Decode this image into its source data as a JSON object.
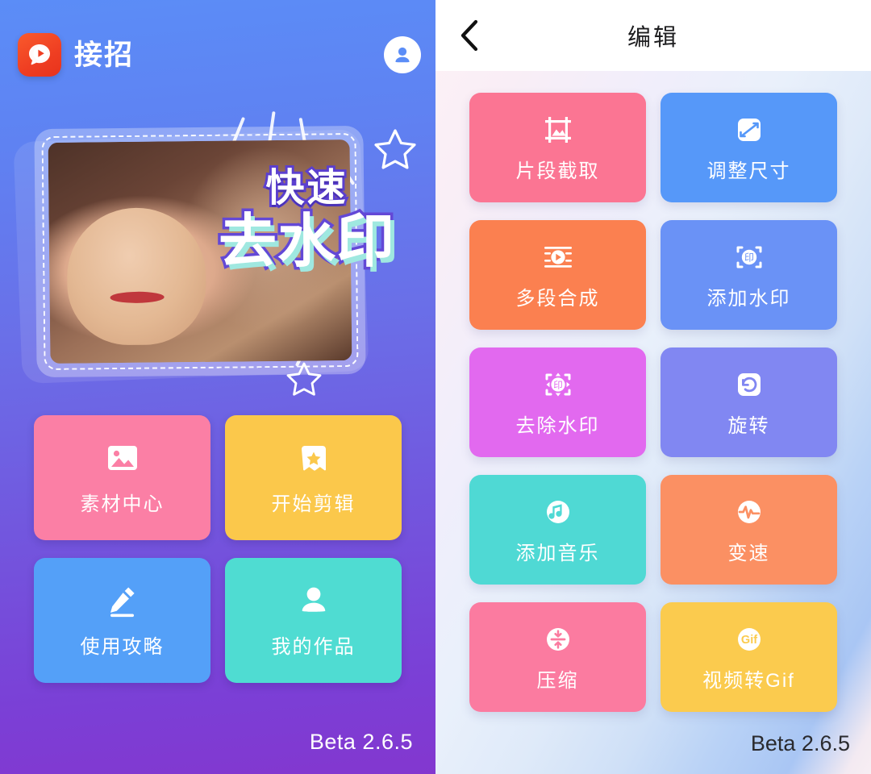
{
  "app": {
    "name": "接招",
    "logo_icon": "play-bubble-icon",
    "avatar_icon": "account-avatar-icon",
    "version": "Beta 2.6.5"
  },
  "home": {
    "hero": {
      "line1": "快速",
      "line2": "去水印",
      "photo_alt": "smiling-woman-photo",
      "colors": {
        "text_fill": "#ffffff",
        "text_stroke": "#5b3fd0",
        "text_shadow": "#9fe8e0"
      }
    },
    "tiles": [
      {
        "label": "素材中心",
        "icon": "image-icon",
        "color": "#fb7fa5"
      },
      {
        "label": "开始剪辑",
        "icon": "star-badge-icon",
        "color": "#fbc84b"
      },
      {
        "label": "使用攻略",
        "icon": "pencil-icon",
        "color": "#54a0f8"
      },
      {
        "label": "我的作品",
        "icon": "person-icon",
        "color": "#4fdcd2"
      }
    ],
    "background": {
      "top": "#5b8df7",
      "bottom": "#8337cf"
    }
  },
  "edit": {
    "title": "编辑",
    "back_icon": "chevron-left-icon",
    "tiles": [
      {
        "label": "片段截取",
        "icon": "crop-icon",
        "color": "#fb7593"
      },
      {
        "label": "调整尺寸",
        "icon": "resize-arrows-icon",
        "color": "#5698f9"
      },
      {
        "label": "多段合成",
        "icon": "film-play-icon",
        "color": "#fb8050"
      },
      {
        "label": "添加水印",
        "icon": "watermark-add-icon",
        "color": "#6a92f6"
      },
      {
        "label": "去除水印",
        "icon": "watermark-remove-icon",
        "color": "#e269ef"
      },
      {
        "label": "旋转",
        "icon": "rotate-icon",
        "color": "#8187f2"
      },
      {
        "label": "添加音乐",
        "icon": "music-note-icon",
        "color": "#4fd9d4"
      },
      {
        "label": "变速",
        "icon": "speed-pulse-icon",
        "color": "#fb9063"
      },
      {
        "label": "压缩",
        "icon": "compress-icon",
        "color": "#fb7ba0"
      },
      {
        "label": "视频转Gif",
        "icon": "gif-icon",
        "color": "#fbcb4e"
      }
    ],
    "version": "Beta 2.6.5"
  }
}
